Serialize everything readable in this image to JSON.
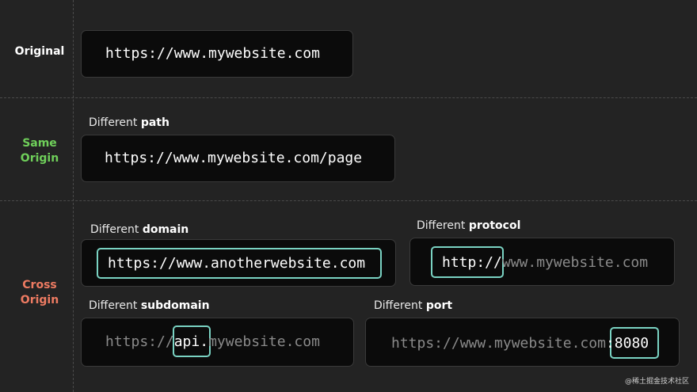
{
  "colors": {
    "background": "#232323",
    "same_origin": "#6fcf5a",
    "cross_origin": "#ee7b62",
    "highlight": "#7ad3c3"
  },
  "rows": {
    "original_label": "Original",
    "same_label_1": "Same",
    "same_label_2": "Origin",
    "cross_label_1": "Cross",
    "cross_label_2": "Origin"
  },
  "original": {
    "url": "https://www.mywebsite.com"
  },
  "path": {
    "caption_prefix": "Different ",
    "caption_bold": "path",
    "url": "https://www.mywebsite.com/page"
  },
  "domain": {
    "caption_prefix": "Different ",
    "caption_bold": "domain",
    "url": "https://www.anotherwebsite.com"
  },
  "protocol": {
    "caption_prefix": "Different ",
    "caption_bold": "protocol",
    "url_highlight": "http://",
    "url_rest": "www.mywebsite.com"
  },
  "subdomain": {
    "caption_prefix": "Different ",
    "caption_bold": "subdomain",
    "url_before": "https://",
    "url_highlight": "api.",
    "url_after": "mywebsite.com"
  },
  "port": {
    "caption_prefix": "Different ",
    "caption_bold": "port",
    "url_before": "https://www.mywebsite.com",
    "url_highlight": ":8080"
  },
  "watermark": "@稀土掘金技术社区"
}
